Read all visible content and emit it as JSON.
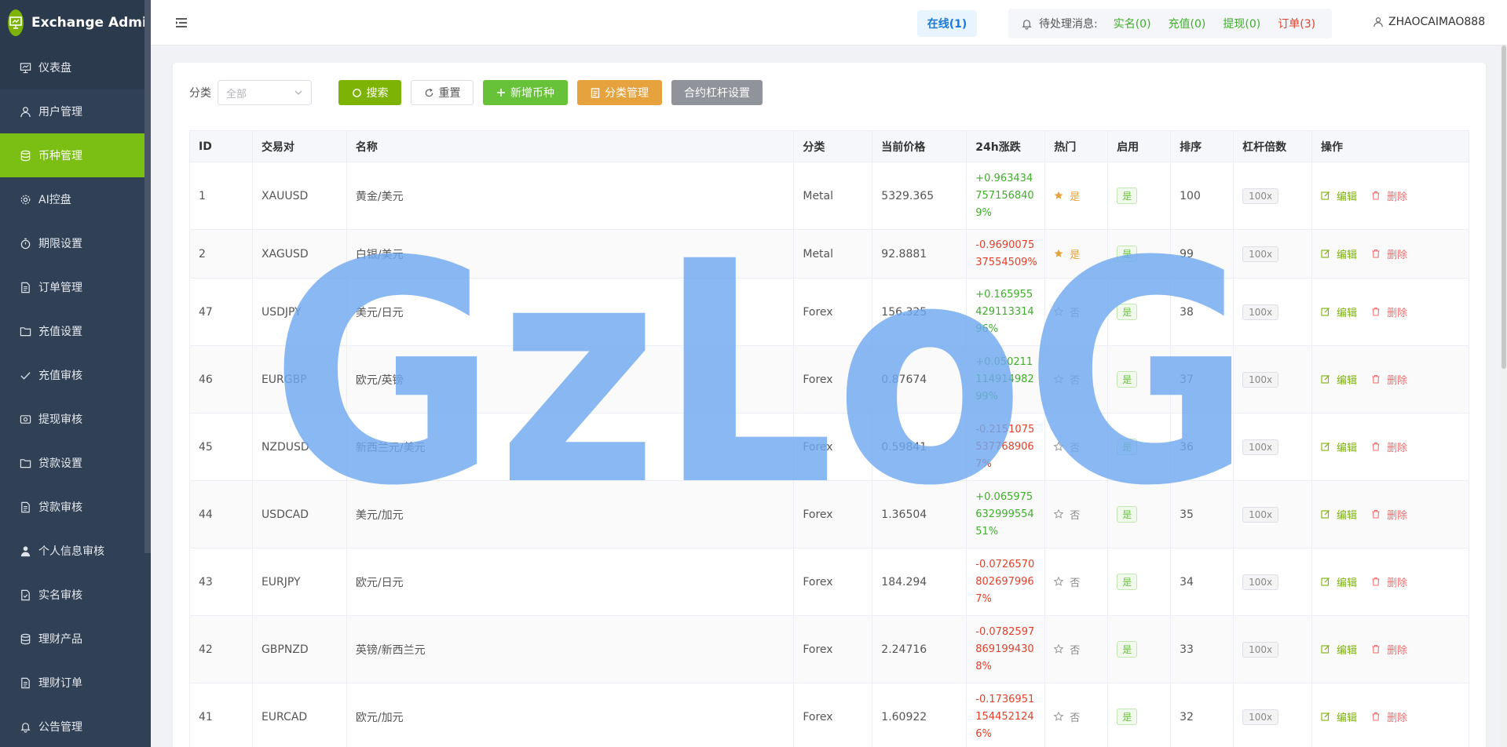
{
  "brand": {
    "title": "Exchange Admin"
  },
  "sidebar": {
    "items": [
      {
        "label": "仪表盘",
        "icon": "dashboard-icon"
      },
      {
        "label": "用户管理",
        "icon": "user-icon"
      },
      {
        "label": "币种管理",
        "icon": "database-icon",
        "active": true
      },
      {
        "label": "AI控盘",
        "icon": "gear-icon"
      },
      {
        "label": "期限设置",
        "icon": "timer-icon"
      },
      {
        "label": "订单管理",
        "icon": "document-icon"
      },
      {
        "label": "充值设置",
        "icon": "folder-icon"
      },
      {
        "label": "充值审核",
        "icon": "check-icon"
      },
      {
        "label": "提现审核",
        "icon": "wallet-icon"
      },
      {
        "label": "贷款设置",
        "icon": "folder-icon"
      },
      {
        "label": "贷款审核",
        "icon": "document-icon"
      },
      {
        "label": "个人信息审核",
        "icon": "person-icon"
      },
      {
        "label": "实名审核",
        "icon": "document-check-icon"
      },
      {
        "label": "理财产品",
        "icon": "database-icon"
      },
      {
        "label": "理财订单",
        "icon": "document-icon"
      },
      {
        "label": "公告管理",
        "icon": "bell-icon"
      }
    ]
  },
  "header": {
    "online": "在线(1)",
    "notice_label": "待处理消息:",
    "notice_realname": "实名(0)",
    "notice_recharge": "充值(0)",
    "notice_withdraw": "提现(0)",
    "notice_orders": "订单(3)",
    "username": "ZHAOCAIMAO888"
  },
  "toolbar": {
    "filter_label": "分类",
    "select_value": "全部",
    "search": "搜索",
    "reset": "重置",
    "add": "新增币种",
    "category": "分类管理",
    "leverage": "合约杠杆设置"
  },
  "table": {
    "headers": [
      "ID",
      "交易对",
      "名称",
      "分类",
      "当前价格",
      "24h涨跌",
      "热门",
      "启用",
      "排序",
      "杠杆倍数",
      "操作"
    ],
    "edit_label": "编辑",
    "delete_label": "删除",
    "rows": [
      {
        "id": "1",
        "pair": "XAUUSD",
        "name": "黄金/美元",
        "category": "Metal",
        "price": "5329.365",
        "change": "+0.9634347571568409%",
        "dir": "up",
        "hot": "是",
        "hot_on": true,
        "enabled": "是",
        "sort": "100",
        "leverage": "100x"
      },
      {
        "id": "2",
        "pair": "XAGUSD",
        "name": "白银/美元",
        "category": "Metal",
        "price": "92.8881",
        "change": "-0.969007537554509%",
        "dir": "down",
        "hot": "是",
        "hot_on": true,
        "enabled": "是",
        "sort": "99",
        "leverage": "100x"
      },
      {
        "id": "47",
        "pair": "USDJPY",
        "name": "美元/日元",
        "category": "Forex",
        "price": "156.325",
        "change": "+0.16595542911331496%",
        "dir": "up",
        "hot": "否",
        "hot_on": false,
        "enabled": "是",
        "sort": "38",
        "leverage": "100x"
      },
      {
        "id": "46",
        "pair": "EURGBP",
        "name": "欧元/英镑",
        "category": "Forex",
        "price": "0.87674",
        "change": "+0.05021111491498299%",
        "dir": "up",
        "hot": "否",
        "hot_on": false,
        "enabled": "是",
        "sort": "37",
        "leverage": "100x"
      },
      {
        "id": "45",
        "pair": "NZDUSD",
        "name": "新西兰元/美元",
        "category": "Forex",
        "price": "0.59841",
        "change": "-0.21510755377689067%",
        "dir": "down",
        "hot": "否",
        "hot_on": false,
        "enabled": "是",
        "sort": "36",
        "leverage": "100x"
      },
      {
        "id": "44",
        "pair": "USDCAD",
        "name": "美元/加元",
        "category": "Forex",
        "price": "1.36504",
        "change": "+0.06597563299955451%",
        "dir": "up",
        "hot": "否",
        "hot_on": false,
        "enabled": "是",
        "sort": "35",
        "leverage": "100x"
      },
      {
        "id": "43",
        "pair": "EURJPY",
        "name": "欧元/日元",
        "category": "Forex",
        "price": "184.294",
        "change": "-0.07265708026979967%",
        "dir": "down",
        "hot": "否",
        "hot_on": false,
        "enabled": "是",
        "sort": "34",
        "leverage": "100x"
      },
      {
        "id": "42",
        "pair": "GBPNZD",
        "name": "英镑/新西兰元",
        "category": "Forex",
        "price": "2.24716",
        "change": "-0.07825978691994308%",
        "dir": "down",
        "hot": "否",
        "hot_on": false,
        "enabled": "是",
        "sort": "33",
        "leverage": "100x"
      },
      {
        "id": "41",
        "pair": "EURCAD",
        "name": "欧元/加元",
        "category": "Forex",
        "price": "1.60922",
        "change": "-0.17369511544521246%",
        "dir": "down",
        "hot": "否",
        "hot_on": false,
        "enabled": "是",
        "sort": "32",
        "leverage": "100x"
      }
    ]
  },
  "watermark": {
    "text": "GzLoG",
    "color": "#6fa8f0"
  }
}
